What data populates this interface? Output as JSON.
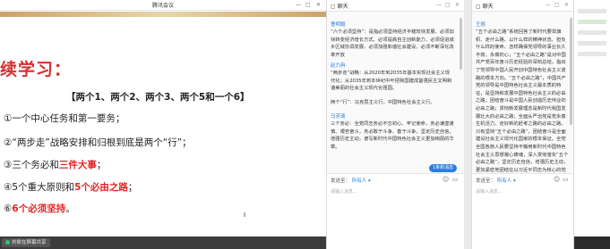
{
  "meeting": {
    "title": "腾讯会议",
    "window_controls": [
      "—",
      "□",
      "✕"
    ],
    "slide": {
      "heading": "续学习：",
      "subtitle": "【两个1、两个2、两个3、两个5和一个6】",
      "items": [
        {
          "prefix": "①一个中心任务和第一要务；",
          "highlight": "",
          "suffix": ""
        },
        {
          "prefix": "②“两步走”战略安排和归根到底是两个“行”；",
          "highlight": "",
          "suffix": ""
        },
        {
          "prefix": "③三个务必和",
          "highlight": "三件大事",
          "suffix": "；"
        },
        {
          "prefix": "④5个重大原则和",
          "highlight": "5个必由之路",
          "suffix": "；"
        },
        {
          "prefix": "⑥",
          "highlight": "6个必须坚持",
          "suffix": "。"
        }
      ],
      "cursor": "I"
    },
    "status": {
      "share_text": "刘俊在屏幕共享"
    }
  },
  "chat_left": {
    "header": "聊天",
    "window_controls": [
      "—",
      "□",
      "✕"
    ],
    "messages": [
      {
        "sender": "曹明翰",
        "text": "“六个必须坚持”：是指必须坚持经济平稳较快发展、必须加快转变经济增长方式、必须提高自主创新能力、必须促进城乡区域协调发展、必须加强和谐社会建设、必须不断深化改革开放"
      },
      {
        "sender": "赵力冉",
        "text": "“两步走”战略：从2020年到2035年基本实现社会主义现代化；从2035年到本世纪中叶把我国建成富强民主文明和谐美丽的社会主义现代化强国。"
      },
      {
        "sender": "",
        "text": "两个“行”：马克思主义行，中国特色社会主义行。"
      },
      {
        "sender": "马芳琦",
        "text": "三个务必：全党同志务必不忘初心、牢记使命，务必谦虚谨慎、艰苦奋斗，务必敢于斗争、善于斗争，坚定历史自信，增强历史主动，谱写新时代中国特色社会主义更加绚丽的华章。"
      }
    ],
    "new_message_btn": "1条新消息",
    "send_to_label": "发送至：",
    "send_to_value": "所有人",
    "input_placeholder": "请输入消息...",
    "icons": [
      "smile-icon",
      "folder-icon"
    ]
  },
  "chat_right": {
    "header": "聊天",
    "window_controls": [
      "—",
      "□",
      "✕"
    ],
    "messages": [
      {
        "sender": "王晗",
        "text": "“五个必由之路”系统回答了新时代要举旗帜、走什么路、以什么样的精神状态、担负什么样的使命、怎样确保党领导的事业长久不衰、永葆初心；“五个必由之路”是对中国共产党百年奋斗历史经验的深刻总结，指出了党领导中国人民开创中国特色社会主义道路的根本方向。“五个必由之路”，中国共产党的领导是中国特色社会主义最本质的特征，是坚持和发展中国特色社会主义的必由之路；团结奋斗是中国人民创造历史伟业的必由之路；贯彻新发展理念是新时代我国发展壮大的必由之路；全面从严治党是党永葆生机活力、走好新的赶考之路的必由之路。只有坚持“五个必由之路”，团结奋斗是全面建设社会主义现代化国家的根本保证。全党全国各族人民要坚持不懈用新时代中国特色社会主义思想凝心铸魂，深入贯彻落实“五个必由之路”，坚定历史自信，增强历史主动，更加紧密地团结在以习近平同志为核心的党中央周围，埋头苦干、勇毅前行，为全面建成社会主义现代化强国、实现中华民族伟大复兴的中国梦而团结奋斗。"
      }
    ],
    "send_to_label": "发送至：",
    "send_to_value": "所有人",
    "input_placeholder": "请输入消息...",
    "icons": [
      "smile-icon",
      "folder-icon"
    ]
  },
  "colors": {
    "accent_blue": "#2a7de1",
    "slide_red": "#e02424",
    "status_green": "#2ec46a"
  }
}
